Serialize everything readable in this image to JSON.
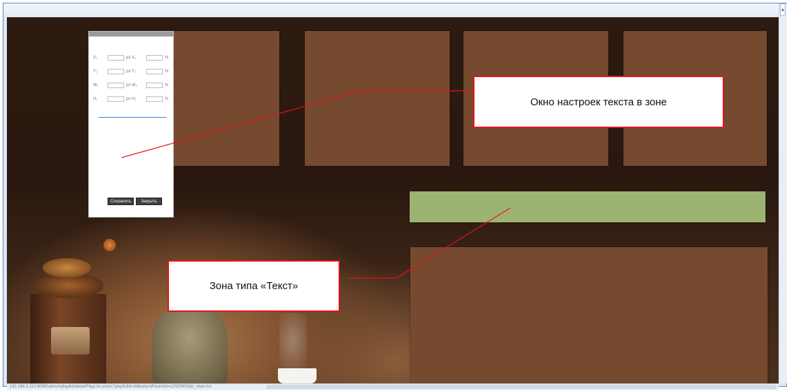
{
  "callouts": {
    "settings_window": "Окно настроек текста в зоне",
    "text_zone": "Зона типа «Текст»"
  },
  "panel": {
    "rows": [
      {
        "a": "X₁",
        "b": "px X₁",
        "c": "%"
      },
      {
        "a": "Y₁",
        "b": "px Y₁",
        "c": "%"
      },
      {
        "a": "W₁",
        "b": "px W₂",
        "c": "%"
      },
      {
        "a": "H₁",
        "b": "px H₁",
        "c": "%"
      }
    ],
    "save_label": "Сохранить",
    "close_label": "Закрыть"
  },
  "status": {
    "url": "192.168.3.110:8088/sdmvA/playlist/detail/PlayList.action?playlistId=34&returnParamId=12020000&is_view=1#"
  },
  "colors": {
    "zone_brown": "#764a2f",
    "zone_green": "#9db372",
    "callout_border": "#e3141b",
    "pointer_line": "#e3141b"
  }
}
